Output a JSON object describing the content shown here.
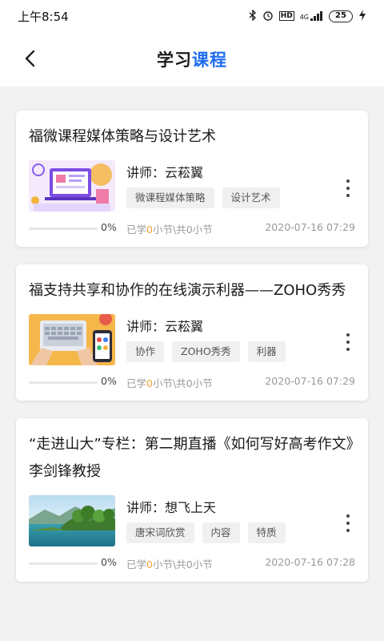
{
  "status_bar": {
    "time": "上午8:54",
    "network": "4G",
    "hd": "HD",
    "battery": "25"
  },
  "header": {
    "title_part1": "学习",
    "title_part2": "课程"
  },
  "colors": {
    "accent": "#1e6cf2",
    "highlight": "#f2a23a"
  },
  "courses": [
    {
      "title": "福微课程媒体策略与设计艺术",
      "teacher": "讲师：云菘翼",
      "tags": [
        "微课程媒体策略",
        "设计艺术"
      ],
      "progress": 0,
      "progress_text": "0%",
      "stats": {
        "prefix": "已学",
        "learned": "0",
        "middle": "小节\\共",
        "total": "0",
        "suffix": "小节"
      },
      "date": "2020-07-16 07:29",
      "thumb_icon": "presentation-illustration"
    },
    {
      "title": "福支持共享和协作的在线演示利器——ZOHO秀秀",
      "teacher": "讲师：云菘翼",
      "tags": [
        "协作",
        "ZOHO秀秀",
        "利器"
      ],
      "progress": 0,
      "progress_text": "0%",
      "stats": {
        "prefix": "已学",
        "learned": "0",
        "middle": "小节\\共",
        "total": "0",
        "suffix": "小节"
      },
      "date": "2020-07-16 07:29",
      "thumb_icon": "laptop-keyboard-illustration"
    },
    {
      "title": "“走进山大”专栏：第二期直播《如何写好高考作文》李剑锋教授",
      "teacher": "讲师：想飞上天",
      "tags": [
        "唐宋词欣赏",
        "内容",
        "特质"
      ],
      "progress": 0,
      "progress_text": "0%",
      "stats": {
        "prefix": "已学",
        "learned": "0",
        "middle": "小节\\共",
        "total": "0",
        "suffix": "小节"
      },
      "date": "2020-07-16 07:28",
      "thumb_icon": "landscape-photo"
    }
  ]
}
